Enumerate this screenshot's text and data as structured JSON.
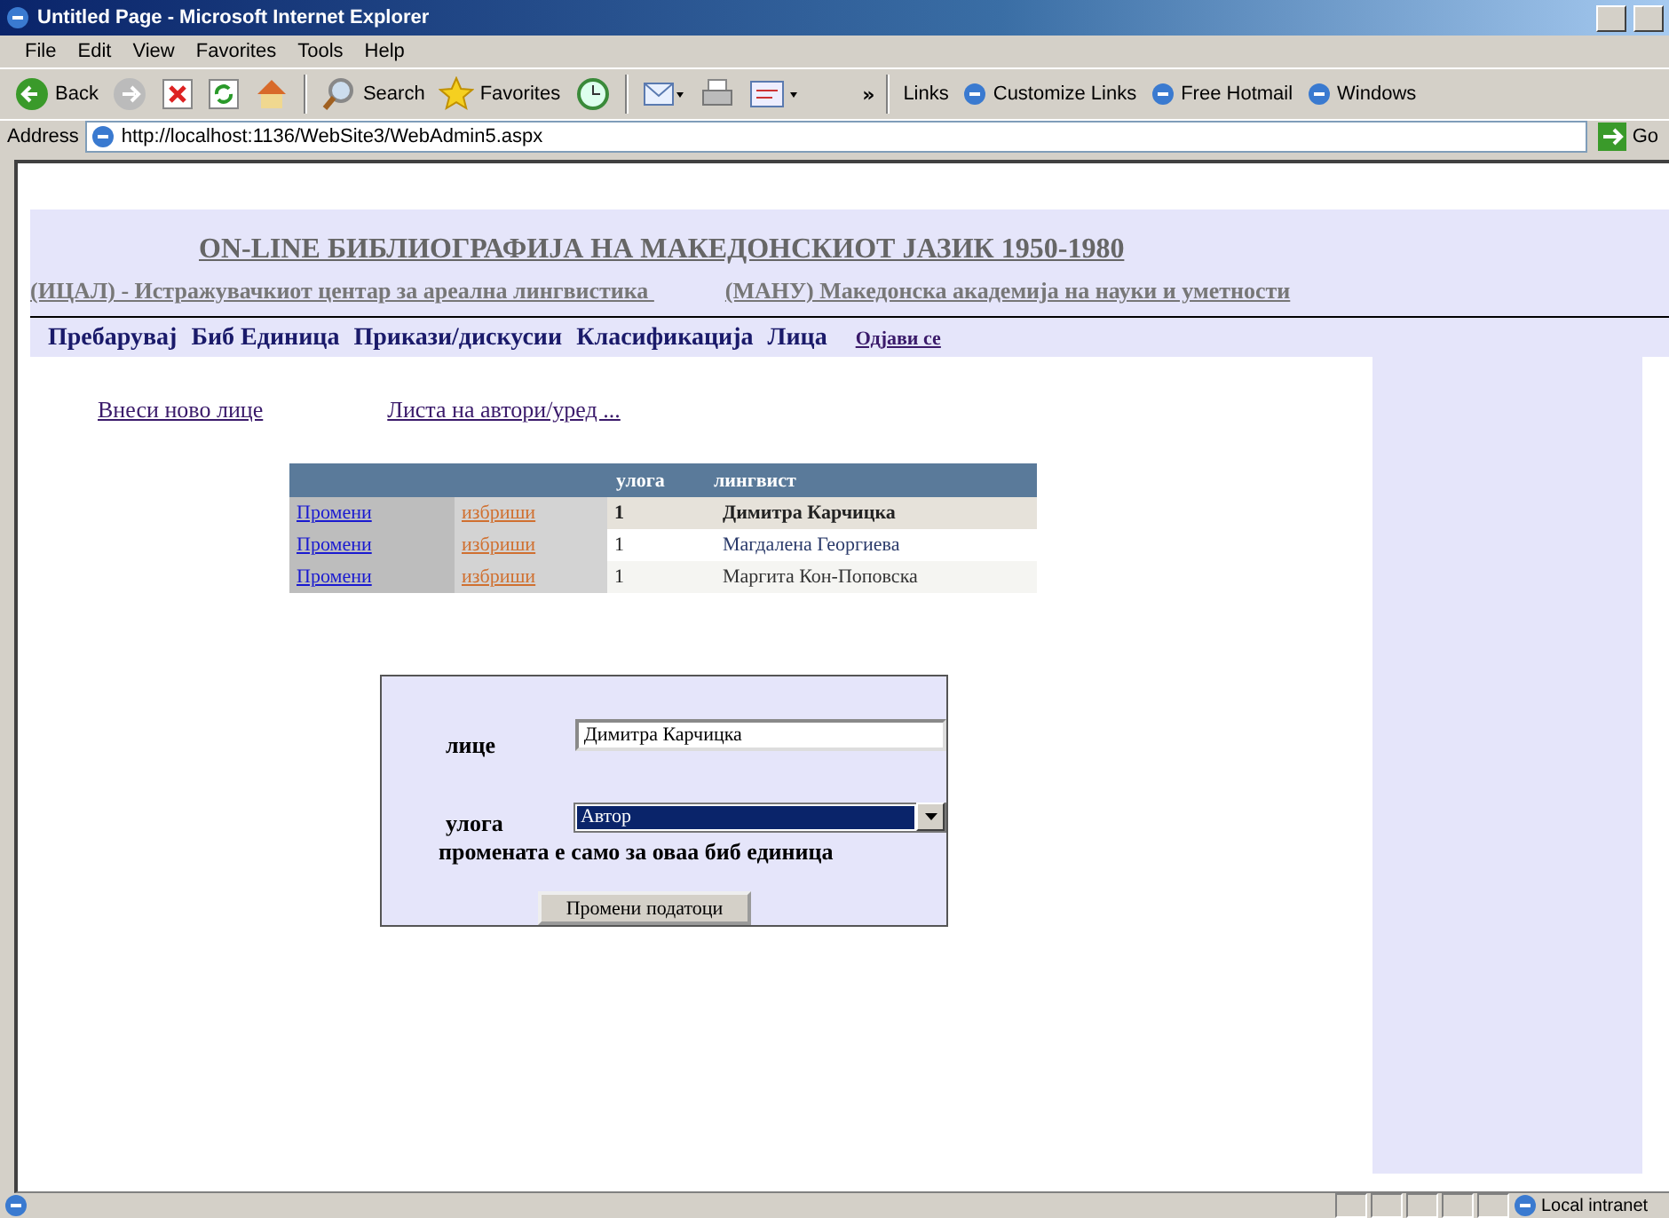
{
  "window": {
    "title": "Untitled Page - Microsoft Internet Explorer"
  },
  "menu": [
    "File",
    "Edit",
    "View",
    "Favorites",
    "Tools",
    "Help"
  ],
  "toolbar": [
    {
      "kind": "back",
      "label": "Back"
    },
    {
      "kind": "forward"
    },
    {
      "kind": "stop"
    },
    {
      "kind": "refresh"
    },
    {
      "kind": "home"
    },
    {
      "kind": "search",
      "label": "Search"
    },
    {
      "kind": "favorites",
      "label": "Favorites"
    },
    {
      "kind": "history"
    },
    {
      "kind": "mail"
    },
    {
      "kind": "print"
    },
    {
      "kind": "edit"
    }
  ],
  "chevron": "»",
  "links": {
    "label": "Links",
    "items": [
      "Customize Links",
      "Free Hotmail",
      "Windows"
    ]
  },
  "address": {
    "label": "Address",
    "value": "http://localhost:1136/WebSite3/WebAdmin5.aspx",
    "go": "Go"
  },
  "page": {
    "heading": "ON-LINE БИБЛИОГРАФИЈА НА МАКЕДОНСКИОТ ЈАЗИК 1950-1980",
    "institutes": [
      "(ИЦАЛ) - Истражувачкиот центар за ареална лингвистика ",
      "(МАНУ) Македонска академија на науки и уметности"
    ],
    "nav": [
      "Пребарувај",
      "Биб Единица",
      "Прикази/дискусии",
      "Класификација",
      "Лица"
    ],
    "logout": "Одјави се",
    "actions": [
      "Внеси ново лице",
      "Листа на автори/уред ..."
    ],
    "table": {
      "columns": [
        "",
        "",
        "улога",
        "лингвист"
      ],
      "rows": [
        {
          "edit": "Промени",
          "delete": "избриши",
          "role": "1",
          "name": "Димитра Карчицка",
          "selected": true
        },
        {
          "edit": "Промени",
          "delete": "избриши",
          "role": "1",
          "name": "Магдалена Георгиева",
          "selected": false
        },
        {
          "edit": "Промени",
          "delete": "избриши",
          "role": "1",
          "name": "Маргита Кон-Поповска",
          "selected": false
        }
      ]
    },
    "form": {
      "person_label": "лице",
      "person_value": "Димитра Карчицка",
      "role_label": "улога",
      "role_value": "Автор",
      "note": "промената  е само за оваа биб единица",
      "submit": "Промени податоци"
    }
  },
  "status_bar": {
    "zone": "Local intranet"
  }
}
